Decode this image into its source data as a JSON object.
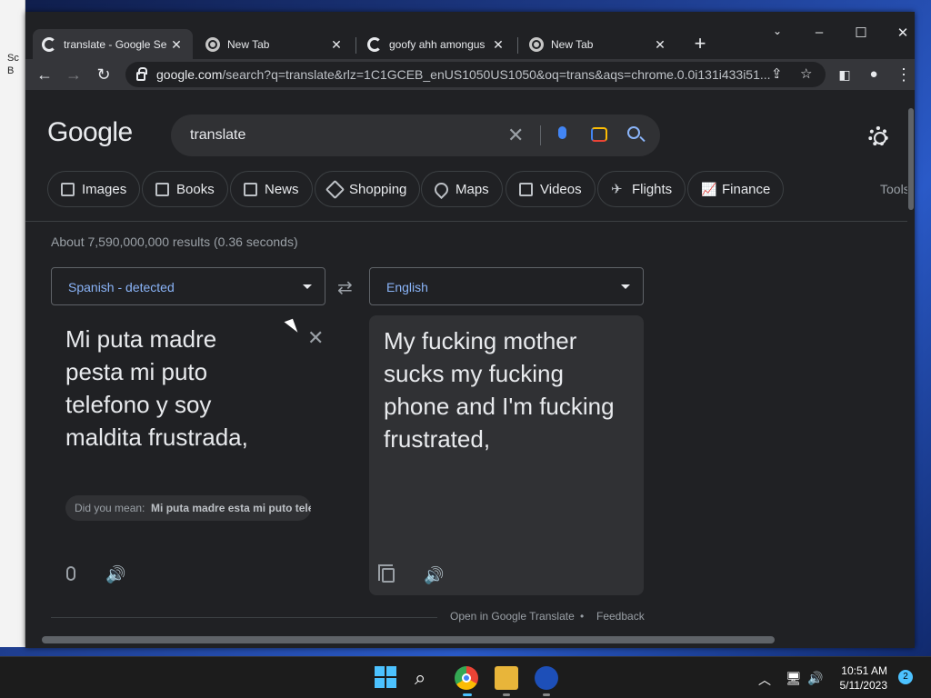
{
  "desktop": {
    "behind_window_text": [
      "Sc",
      "B"
    ]
  },
  "tabs": [
    {
      "label": "translate - Google Se",
      "active": true,
      "icon": "google-icon"
    },
    {
      "label": "New Tab",
      "active": false,
      "icon": "chrome-icon"
    },
    {
      "label": "goofy ahh amongus",
      "active": false,
      "icon": "google-icon"
    },
    {
      "label": "New Tab",
      "active": false,
      "icon": "chrome-icon"
    }
  ],
  "toolbar": {
    "url_host": "google.com",
    "url_rest": "/search?q=translate&rlz=1C1GCEB_enUS1050US1050&oq=trans&aqs=chrome.0.0i131i433i51..."
  },
  "google": {
    "logo": "Google",
    "query": "translate",
    "chips": [
      "Images",
      "Books",
      "News",
      "Shopping",
      "Maps",
      "Videos",
      "Flights",
      "Finance"
    ],
    "tools": "Tools",
    "stats": "About 7,590,000,000 results (0.36 seconds)"
  },
  "translate": {
    "source_lang": "Spanish - detected",
    "target_lang": "English",
    "source_text": "Mi puta madre pesta mi puto telefono y soy maldita frustrada,",
    "did_you_mean_label": "Did you mean:",
    "did_you_mean_value": "Mi puta madre esta mi puto telefono y soy maldita frustrada",
    "target_text": "My fucking mother sucks my fucking phone and I'm fucking frustrated,",
    "open_link": "Open in Google Translate",
    "feedback": "Feedback",
    "separator": "•"
  },
  "taskbar": {
    "time": "10:51 AM",
    "date": "5/11/2023",
    "notification_count": "2"
  },
  "colors": {
    "accent": "#8ab4f8",
    "page_bg": "#202124",
    "taskbar_accent": "#4cc2ff"
  }
}
